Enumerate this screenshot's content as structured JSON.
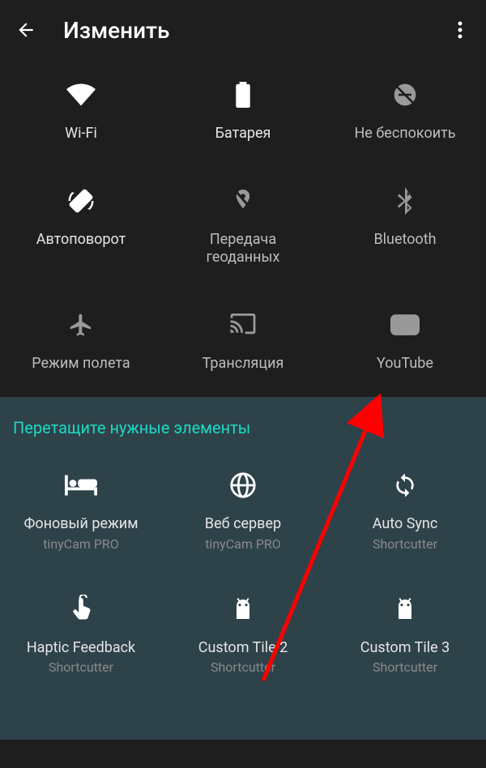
{
  "header": {
    "title": "Изменить"
  },
  "active_tiles": [
    {
      "name": "wifi",
      "label": "Wi-Fi",
      "dim": false
    },
    {
      "name": "battery",
      "label": "Батарея",
      "dim": false
    },
    {
      "name": "dnd",
      "label": "Не беспокоить",
      "dim": true
    },
    {
      "name": "autorotate",
      "label": "Автоповорот",
      "dim": false
    },
    {
      "name": "location",
      "label": "Передача\nгеоданных",
      "dim": true
    },
    {
      "name": "bluetooth",
      "label": "Bluetooth",
      "dim": true
    },
    {
      "name": "airplane",
      "label": "Режим полета",
      "dim": true
    },
    {
      "name": "cast",
      "label": "Трансляция",
      "dim": true
    },
    {
      "name": "youtube",
      "label": "YouTube",
      "dim": true
    }
  ],
  "available": {
    "title": "Перетащите нужные элементы",
    "tiles": [
      {
        "name": "background-mode",
        "label": "Фоновый режим",
        "sub": "tinyCam PRO"
      },
      {
        "name": "web-server",
        "label": "Веб сервер",
        "sub": "tinyCam PRO"
      },
      {
        "name": "auto-sync",
        "label": "Auto Sync",
        "sub": "Shortcutter"
      },
      {
        "name": "haptic-feedback",
        "label": "Haptic Feedback",
        "sub": "Shortcutter"
      },
      {
        "name": "custom-tile-2",
        "label": "Custom Tile 2",
        "sub": "Shortcutter"
      },
      {
        "name": "custom-tile-3",
        "label": "Custom Tile 3",
        "sub": "Shortcutter"
      }
    ]
  }
}
